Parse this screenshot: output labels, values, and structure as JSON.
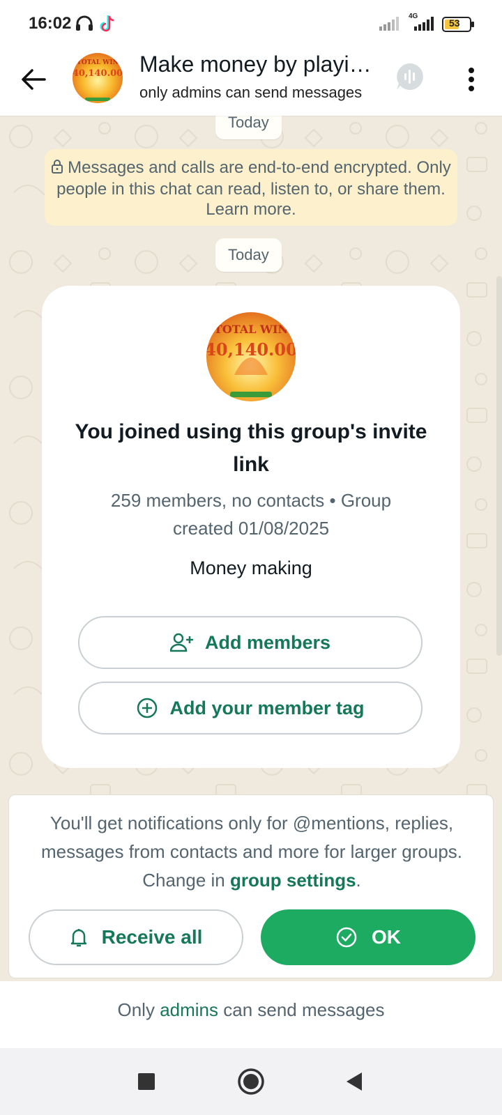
{
  "status_bar": {
    "time": "16:02",
    "network_label": "4G",
    "battery": "53",
    "icons": [
      "headphones-icon",
      "tiktok-icon",
      "signal-icon",
      "network-4g-icon",
      "battery-icon"
    ]
  },
  "header": {
    "title": "Make money by playing games",
    "subtitle": "only admins can send messages",
    "icons": [
      "back-arrow-icon",
      "group-avatar",
      "voice-chat-icon",
      "more-options-icon"
    ]
  },
  "avatar_image": {
    "line1": "TOTAL WIN",
    "line2": "40,140.00"
  },
  "chat": {
    "date_chip_top": "Today",
    "encryption_notice": "Messages and calls are end-to-end encrypted. Only people in this chat can read, listen to, or share them. Learn more.",
    "date_chip": "Today",
    "card": {
      "title": "You joined using this group's invite link",
      "meta": "259 members, no contacts • Group created 01/08/2025",
      "description": "Money making",
      "add_members_label": "Add members",
      "add_tag_label": "Add your member tag"
    }
  },
  "notification_panel": {
    "text_before": "You'll get notifications only for @mentions, replies, messages from contacts and more for larger groups. Change in ",
    "link": "group settings",
    "text_after": ".",
    "receive_all_label": "Receive all",
    "ok_label": "OK"
  },
  "footer": {
    "text_before": "Only ",
    "link": "admins",
    "text_after": " can send messages"
  },
  "system_nav": {
    "icons": [
      "recents-square-icon",
      "home-circle-icon",
      "back-triangle-icon"
    ]
  },
  "colors": {
    "accent_green": "#1daa61",
    "link_green": "#15785a",
    "chat_background": "#efe9de",
    "encryption_notice_bg": "#fdf0cc"
  }
}
